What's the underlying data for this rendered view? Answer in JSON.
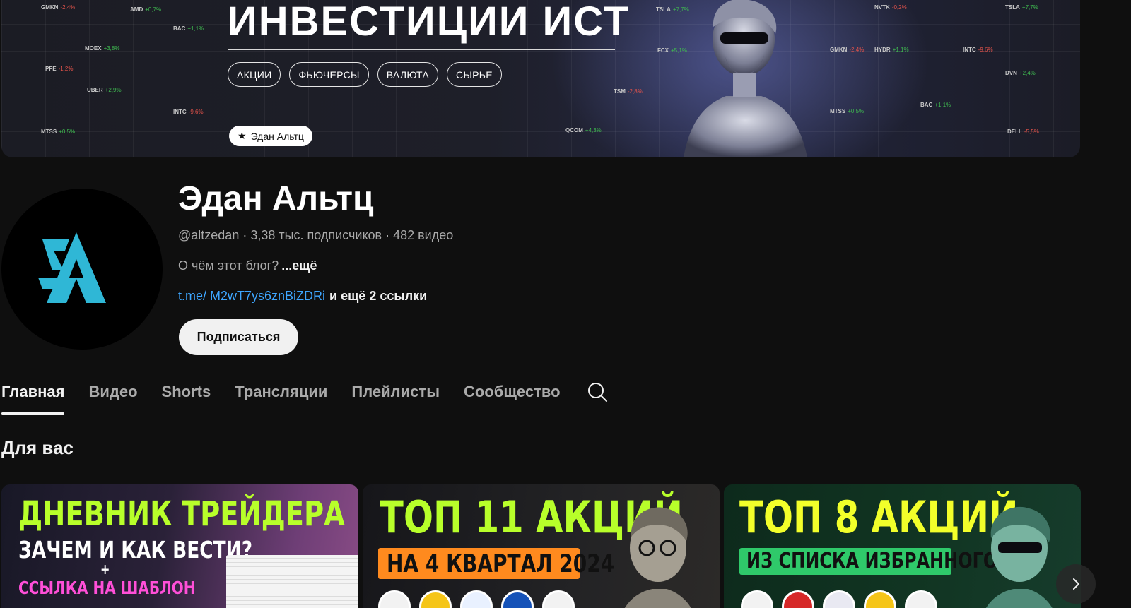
{
  "banner": {
    "title": "ИНВЕСТИЦИИ ИСТ",
    "chips": [
      "АКЦИИ",
      "ФЬЮЧЕРСЫ",
      "ВАЛЮТА",
      "СЫРЬЕ"
    ],
    "name_pill": "Эдан Альтц",
    "tickers": [
      {
        "sym": "GMKN",
        "pct": "-2,4%"
      },
      {
        "sym": "AMD",
        "pct": "+0,7%"
      },
      {
        "sym": "BAC",
        "pct": "+1,1%"
      },
      {
        "sym": "MOEX",
        "pct": "+3,8%"
      },
      {
        "sym": "PFE",
        "pct": "-1,2%"
      },
      {
        "sym": "UBER",
        "pct": "+2,9%"
      },
      {
        "sym": "INTC",
        "pct": "-9,6%"
      },
      {
        "sym": "MTSS",
        "pct": "+0,5%"
      },
      {
        "sym": "QCOM",
        "pct": "+4,3%"
      },
      {
        "sym": "TSLA",
        "pct": "+7,7%"
      },
      {
        "sym": "FCX",
        "pct": "+5,1%"
      },
      {
        "sym": "TSM",
        "pct": "-2,8%"
      },
      {
        "sym": "NVTK",
        "pct": "-0,2%"
      },
      {
        "sym": "GMKN",
        "pct": "-2,4%"
      },
      {
        "sym": "HYDR",
        "pct": "+1,1%"
      },
      {
        "sym": "MTSS",
        "pct": "+0,5%"
      },
      {
        "sym": "INTC",
        "pct": "-9,6%"
      },
      {
        "sym": "BAC",
        "pct": "+1,1%"
      },
      {
        "sym": "TSLA",
        "pct": "+7,7%"
      },
      {
        "sym": "DVN",
        "pct": "+2,4%"
      },
      {
        "sym": "DELL",
        "pct": "-5,5%"
      }
    ]
  },
  "channel": {
    "name": "Эдан Альтц",
    "meta": "@altzedan · 3,38 тыс. подписчиков · 482 видео",
    "about": "О чём этот блог?",
    "about_more": "...ещё",
    "link_url": "t.me/ M2wT7ys6znBiZDRi",
    "link_extra": "и ещё 2 ссылки",
    "subscribe_label": "Подписаться"
  },
  "tabs": [
    "Главная",
    "Видео",
    "Shorts",
    "Трансляции",
    "Плейлисты",
    "Сообщество"
  ],
  "section_title": "Для вас",
  "videos": [
    {
      "line1": "ДНЕВНИК ТРЕЙДЕРА",
      "line2": "ЗАЧЕМ И КАК ВЕСТИ?",
      "plus": "+",
      "line3": "ССЫЛКА НА ШАБЛОН"
    },
    {
      "line1": "ТОП 11 АКЦИЙ",
      "line2": "НА 4 КВАРТАЛ 2024"
    },
    {
      "line1": "ТОП 8 АКЦИЙ",
      "line2": "ИЗ СПИСКА ИЗБРАННОГО"
    }
  ],
  "colors": {
    "background": "#0f0f0f",
    "link": "#3ea6ff",
    "logo": "#2fb7d6"
  }
}
